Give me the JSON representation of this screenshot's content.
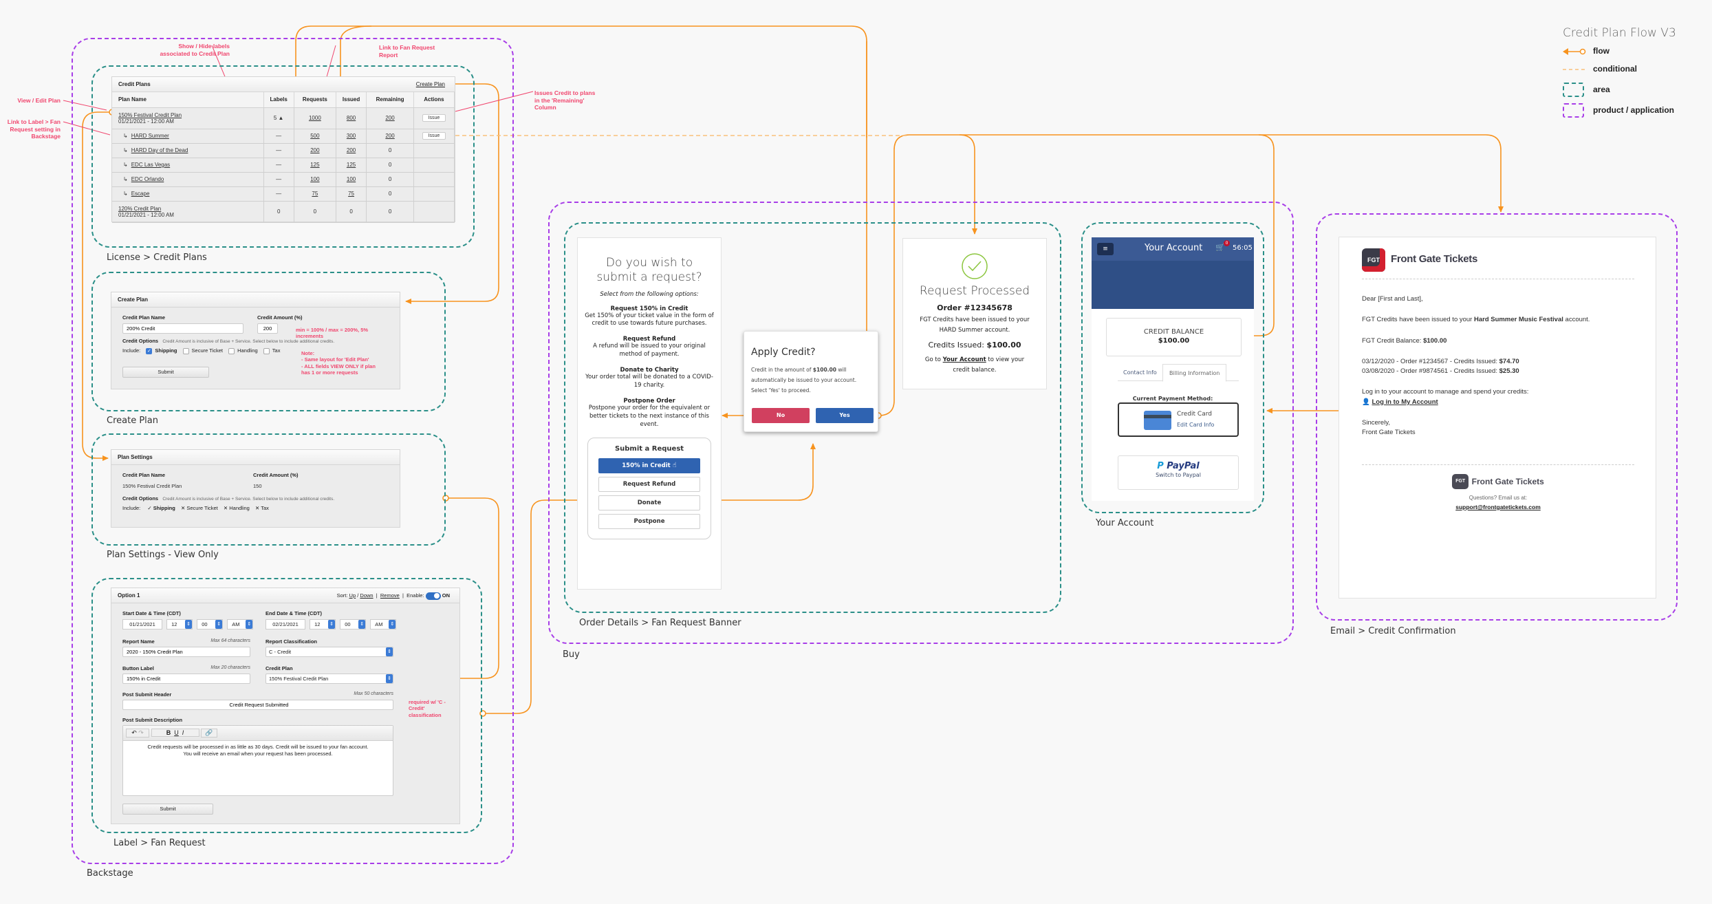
{
  "legend": {
    "title": "Credit Plan Flow V3",
    "items": [
      {
        "key": "flow",
        "label": "flow"
      },
      {
        "key": "conditional",
        "label": "conditional"
      },
      {
        "key": "area",
        "label": "area"
      },
      {
        "key": "product",
        "label": "product / application"
      }
    ]
  },
  "colors": {
    "flow": "#f7931e",
    "annotation": "#f0466e",
    "area": "#2a8f88",
    "product": "#a83ee8",
    "primary_button": "#2f63b1",
    "danger_button": "#d1405f",
    "account_header": "#2f4f86",
    "success": "#8cc63f"
  },
  "captions": {
    "backstage": "Backstage",
    "credit_plans_area": "License > Credit Plans",
    "create_plan_area": "Create Plan",
    "plan_settings_area": "Plan Settings - View Only",
    "label_fan_request_area": "Label > Fan Request",
    "buy": "Buy",
    "order_details_area": "Order Details > Fan Request Banner",
    "your_account_area": "Your Account",
    "email_area": "Email > Credit Confirmation"
  },
  "annotations": {
    "view_edit_plan": "View / Edit Plan",
    "link_label": "Link to Label > Fan Request setting in Backstage",
    "show_hide_labels": "Show / Hide labels associated to Credit Plan",
    "link_report": "Link to Fan Request Report",
    "issues_credit": "Issues Credit to plans in the 'Remaining' Column",
    "credit_amount_rule": "min = 100% / max = 200%, 5% increments",
    "note_title": "Note:",
    "note_line1": "- Same layout for 'Edit Plan'",
    "note_line2": "- ALL fields VIEW ONLY if plan has 1 or more requests",
    "required_credit": "required w/ 'C - Credit' classification"
  },
  "credit_plans": {
    "title": "Credit Plans",
    "create_link": "Create Plan",
    "columns": [
      "Plan Name",
      "Labels",
      "Requests",
      "Issued",
      "Remaining",
      "Actions"
    ],
    "rows": [
      {
        "name": "150% Festival Credit Plan",
        "date": "01/21/2021 - 12:00 AM",
        "labels": "5 ▲",
        "requests": "1000",
        "issued": "800",
        "remaining": "200",
        "action": "Issue",
        "child": false
      },
      {
        "name": "HARD Summer",
        "date": "",
        "labels": "—",
        "requests": "500",
        "issued": "300",
        "remaining": "200",
        "action": "Issue",
        "child": true
      },
      {
        "name": "HARD Day of the Dead",
        "date": "",
        "labels": "—",
        "requests": "200",
        "issued": "200",
        "remaining": "0",
        "action": "",
        "child": true
      },
      {
        "name": "EDC Las Vegas",
        "date": "",
        "labels": "—",
        "requests": "125",
        "issued": "125",
        "remaining": "0",
        "action": "",
        "child": true
      },
      {
        "name": "EDC Orlando",
        "date": "",
        "labels": "—",
        "requests": "100",
        "issued": "100",
        "remaining": "0",
        "action": "",
        "child": true
      },
      {
        "name": "Escape",
        "date": "",
        "labels": "—",
        "requests": "75",
        "issued": "75",
        "remaining": "0",
        "action": "",
        "child": true
      },
      {
        "name": "120% Credit Plan",
        "date": "01/21/2021 - 12:00 AM",
        "labels": "0",
        "requests": "0",
        "issued": "0",
        "remaining": "0",
        "action": "",
        "child": false
      }
    ]
  },
  "create_plan": {
    "title": "Create Plan",
    "name_label": "Credit Plan Name",
    "name_value": "200% Credit",
    "amount_label": "Credit Amount (%)",
    "amount_value": "200",
    "options_label": "Credit Options",
    "options_hint": "Credit Amount is inclusive of Base + Service. Select below to include additional credits.",
    "include_label": "Include:",
    "options": [
      {
        "label": "Shipping",
        "checked": true
      },
      {
        "label": "Secure Ticket",
        "checked": false
      },
      {
        "label": "Handling",
        "checked": false
      },
      {
        "label": "Tax",
        "checked": false
      }
    ],
    "submit": "Submit"
  },
  "plan_settings": {
    "title": "Plan Settings",
    "name_label": "Credit Plan Name",
    "name_value": "150% Festival  Credit Plan",
    "amount_label": "Credit Amount (%)",
    "amount_value": "150",
    "options_label": "Credit Options",
    "options_hint": "Credit Amount is inclusive of Base + Service. Select below to include additional credits.",
    "include_label": "Include:",
    "options": [
      {
        "label": "Shipping",
        "included": true,
        "mark": "✓"
      },
      {
        "label": "Secure Ticket",
        "included": false,
        "mark": "✕"
      },
      {
        "label": "Handling",
        "included": false,
        "mark": "✕"
      },
      {
        "label": "Tax",
        "included": false,
        "mark": "✕"
      }
    ]
  },
  "fan_request": {
    "option_title": "Option 1",
    "sort_label": "Sort:",
    "sort_up": "Up",
    "sort_sep": "/",
    "sort_down": "Down",
    "remove": "Remove",
    "enable_label": "Enable:",
    "enable_state": "ON",
    "start_label": "Start Date & Time (CDT)",
    "start_date": "01/21/2021",
    "start_hour": "12",
    "start_min": "00",
    "start_ampm": "AM",
    "end_label": "End Date & Time (CDT)",
    "end_date": "02/21/2021",
    "end_hour": "12",
    "end_min": "00",
    "end_ampm": "AM",
    "report_name_label": "Report Name",
    "report_name_hint": "Max 64 characters",
    "report_name_value": "2020 - 150% Credit Plan",
    "report_class_label": "Report Classification",
    "report_class_value": "C - Credit",
    "button_label_label": "Button Label",
    "button_label_hint": "Max 20 characters",
    "button_label_value": "150% in Credit",
    "credit_plan_label": "Credit Plan",
    "credit_plan_value": "150% Festival Credit Plan",
    "post_header_label": "Post Submit Header",
    "post_header_hint": "Max 50 characters",
    "post_header_value": "Credit Request Submitted",
    "post_desc_label": "Post Submit Description",
    "post_desc_line1": "Credit requests will be processed in as little as 30 days. Credit will be issued to your fan account.",
    "post_desc_line2": "You will receive an email when your request has been processed.",
    "submit": "Submit"
  },
  "fan_banner": {
    "title": "Do you wish to submit a request?",
    "subtitle": "Select from the following options:",
    "options": [
      {
        "title": "Request 150% in Credit",
        "desc": "Get 150% of your ticket value in the form of credit to use towards future purchases."
      },
      {
        "title": "Request Refund",
        "desc": "A refund will be issued to your original method of payment."
      },
      {
        "title": "Donate to Charity",
        "desc": "Your order total will be donated to a COVID-19 charity."
      },
      {
        "title": "Postpone Order",
        "desc": "Postpone your order for the equivalent or better tickets to the next instance of this event."
      }
    ],
    "box_title": "Submit a Request",
    "buttons": [
      "150% in Credit",
      "Request Refund",
      "Donate",
      "Postpone"
    ]
  },
  "apply_dialog": {
    "title": "Apply Credit?",
    "text_pre": "Credit in the amount of ",
    "amount": "$100.00",
    "text_post": " will automatically be issued to your account. Select 'Yes' to proceed.",
    "no": "No",
    "yes": "Yes"
  },
  "processed": {
    "title": "Request Processed",
    "order": "Order #12345678",
    "message": "FGT Credits have been issued to your HARD Summer account.",
    "credits_label": "Credits Issued: ",
    "credits_value": "$100.00",
    "goto_pre": "Go to ",
    "goto_link": "Your Account",
    "goto_post": " to view your credit balance."
  },
  "account": {
    "title": "Your Account",
    "cart_count": "0",
    "timer": "56:05",
    "balance_label": "CREDIT BALANCE",
    "balance_value": "$100.00",
    "tabs": [
      "Contact Info",
      "Billing Information"
    ],
    "active_tab": "Billing Information",
    "payment_label": "Current Payment Method:",
    "card_title": "Credit Card",
    "card_edit": "Edit Card Info",
    "paypal_logo": "PayPal",
    "paypal_switch": "Switch to Paypal"
  },
  "email": {
    "brand": "Front Gate Tickets",
    "badge": "FGT",
    "greeting": "Dear [First and Last],",
    "line1_pre": "FGT Credits have been issued to your ",
    "line1_bold": "Hard Summer Music Festival",
    "line1_post": " account.",
    "balance_label": "FGT Credit Balance: ",
    "balance_value": "$100.00",
    "orders": [
      {
        "text": "03/12/2020 - Order #1234567 - Credits Issued: ",
        "amount": "$74.70"
      },
      {
        "text": "03/08/2020 - Order #9874561 - Credits Issued: ",
        "amount": "$25.30"
      }
    ],
    "login_prompt": "Log in to your account to manage and spend your credits:",
    "login_link": "Log in to My Account",
    "sign1": "Sincerely,",
    "sign2": "Front Gate Tickets",
    "footer_q": "Questions? Email us at:",
    "footer_email": "support@frontgatetickets.com"
  }
}
